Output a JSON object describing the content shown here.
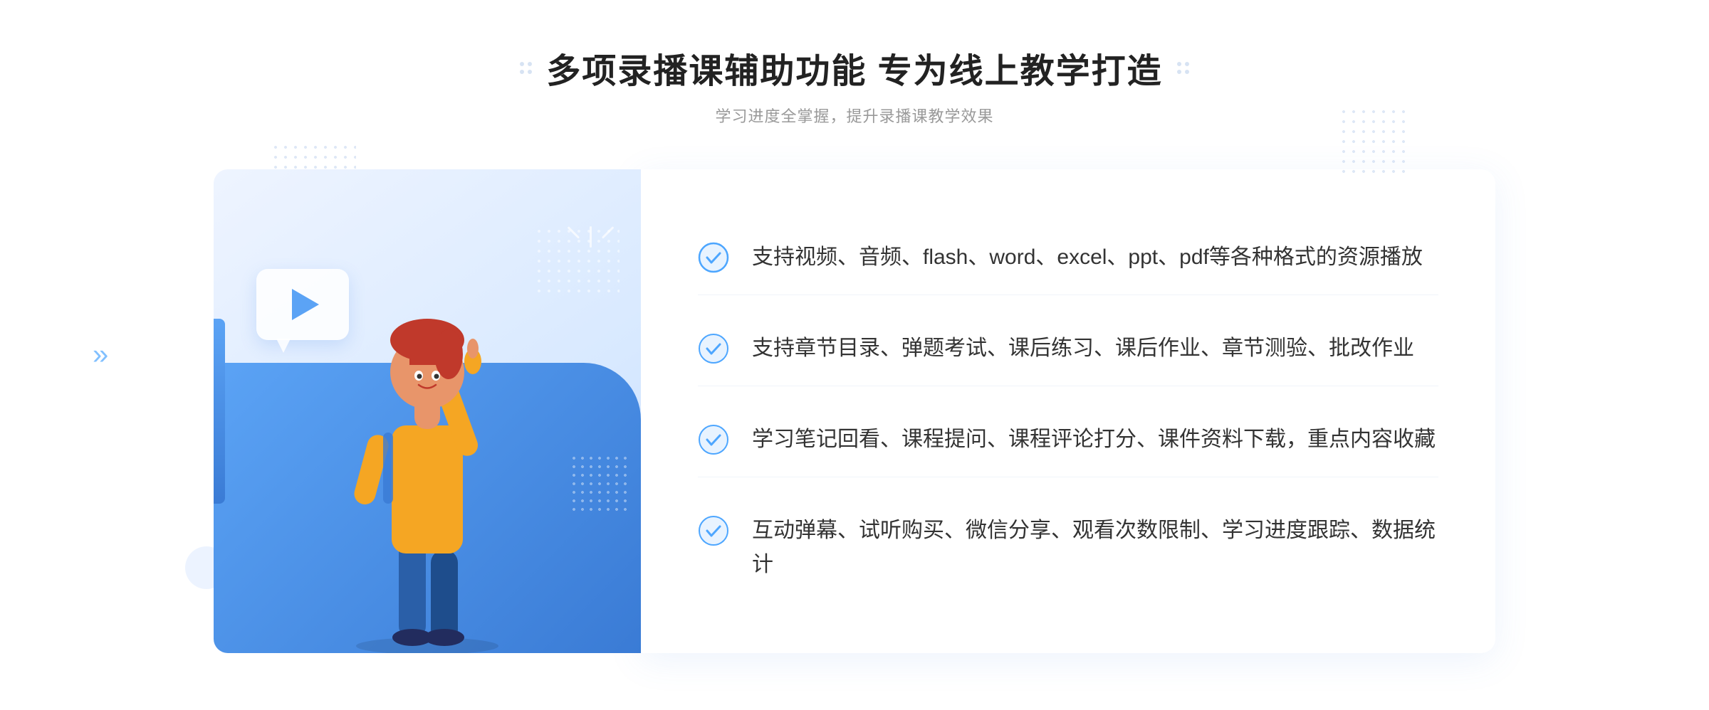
{
  "header": {
    "title": "多项录播课辅助功能 专为线上教学打造",
    "subtitle": "学习进度全掌握，提升录播课教学效果"
  },
  "features": [
    {
      "id": 1,
      "text": "支持视频、音频、flash、word、excel、ppt、pdf等各种格式的资源播放"
    },
    {
      "id": 2,
      "text": "支持章节目录、弹题考试、课后练习、课后作业、章节测验、批改作业"
    },
    {
      "id": 3,
      "text": "学习笔记回看、课程提问、课程评论打分、课件资料下载，重点内容收藏"
    },
    {
      "id": 4,
      "text": "互动弹幕、试听购买、微信分享、观看次数限制、学习进度跟踪、数据统计"
    }
  ],
  "icons": {
    "check_color": "#4da6ff",
    "check_circle_color": "#e8f3ff"
  },
  "decorations": {
    "arrow_symbol": "»",
    "play_label": "play"
  }
}
